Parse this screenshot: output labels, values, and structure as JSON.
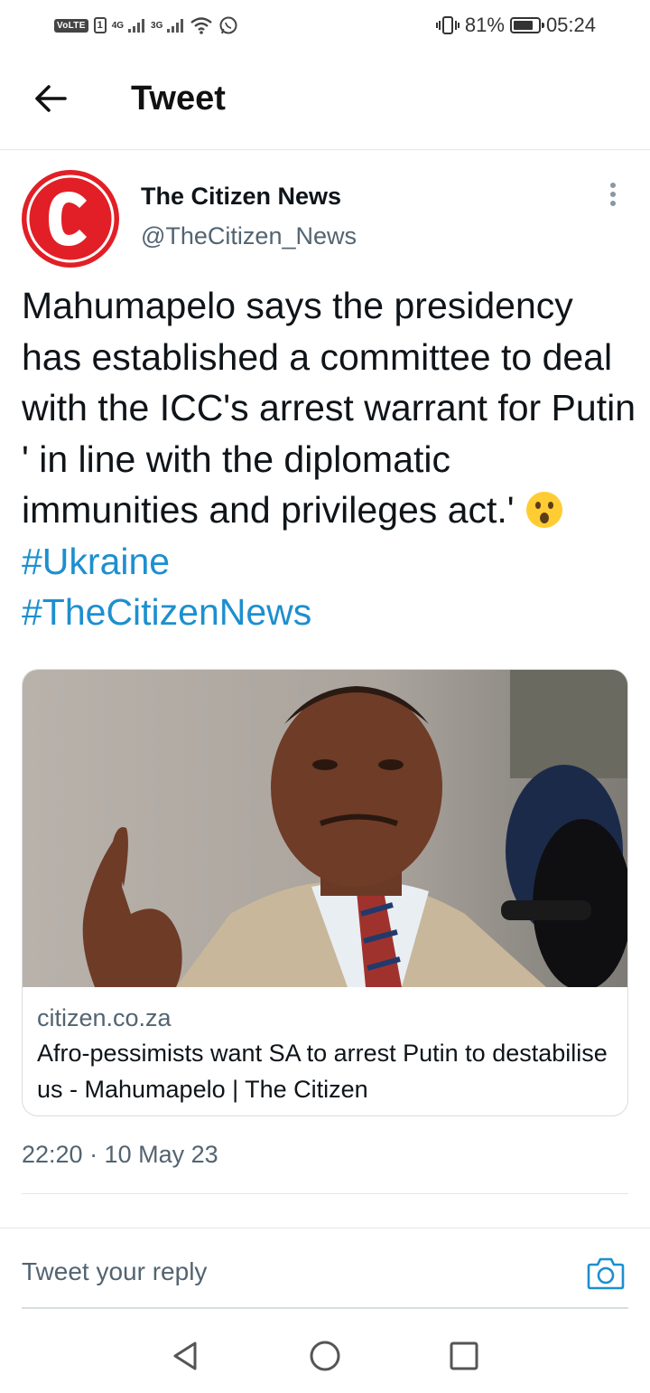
{
  "status_bar": {
    "volte": "VoLTE",
    "sim_slot": "1",
    "network_1": "4G",
    "network_2": "3G",
    "battery_percent": "81%",
    "battery_level": 0.81,
    "time": "05:24",
    "icons": [
      "signal-icon",
      "wifi-icon",
      "whatsapp-icon",
      "vibrate-icon",
      "battery-icon"
    ]
  },
  "header": {
    "title": "Tweet",
    "back_icon": "arrow-left-icon"
  },
  "tweet": {
    "author_name": "The Citizen News",
    "author_handle": "@TheCitizen_News",
    "avatar_letter": "C",
    "text_main": "Mahumapelo says the presidency has established a committee to deal with the ICC's arrest warrant for Putin ' in line with the diplomatic immunities and privileges act.' ",
    "emoji": "😦",
    "hashtags": [
      "#Ukraine",
      "#TheCitizenNews"
    ],
    "card": {
      "domain": "citizen.co.za",
      "title": "Afro-pessimists want SA to arrest Putin to destabilise us - Mahumapelo | The Citizen"
    },
    "timestamp": "22:20 · 10 May 23"
  },
  "reply": {
    "placeholder": "Tweet your reply",
    "camera_icon": "camera-icon"
  },
  "nav": {
    "icons": [
      "back-triangle-icon",
      "home-circle-icon",
      "recents-square-icon"
    ]
  },
  "colors": {
    "accent": "#1d8fcf",
    "brand_red": "#e21f26",
    "secondary_text": "#536471"
  }
}
